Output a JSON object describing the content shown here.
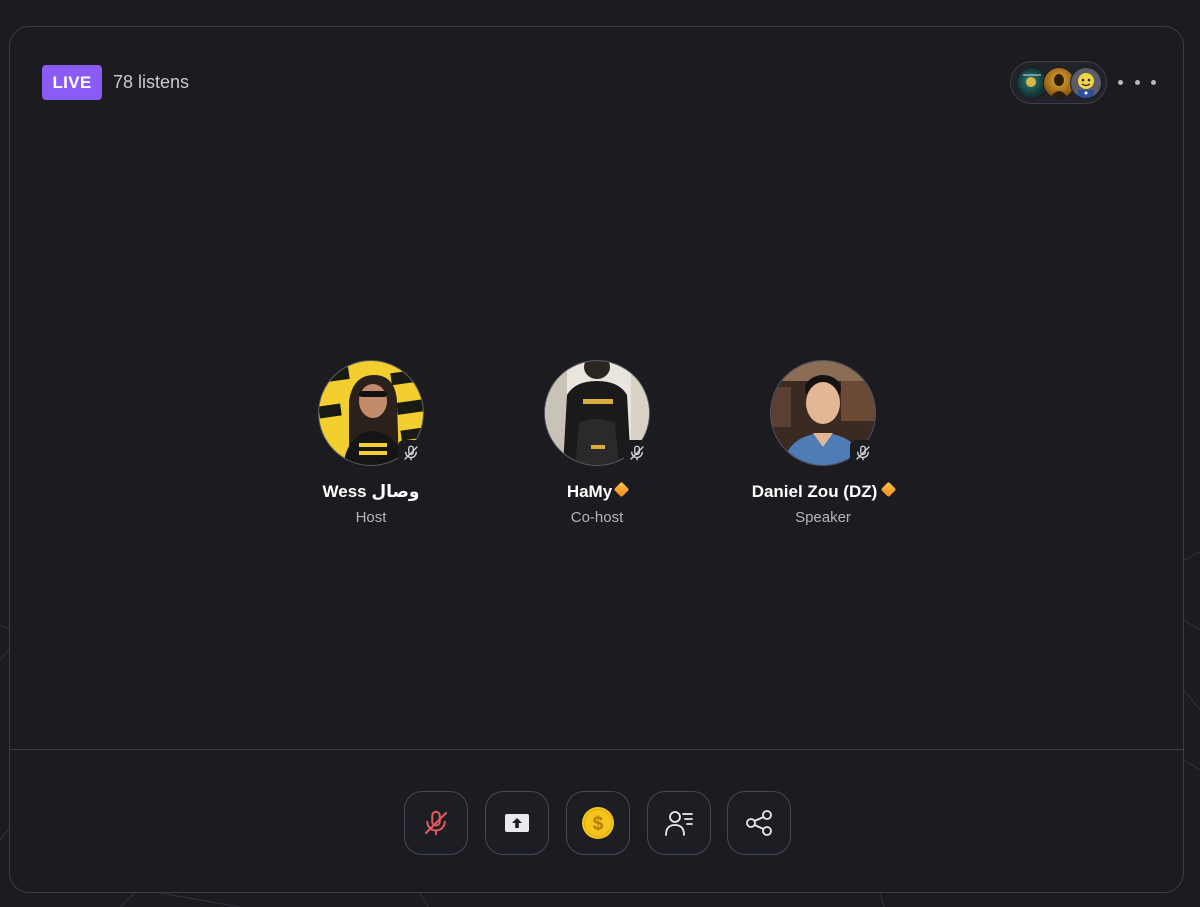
{
  "room": {
    "live_label": "LIVE",
    "listens_text": "78 listens"
  },
  "listeners": [
    {
      "icon": "listener-avatar"
    },
    {
      "icon": "listener-avatar"
    },
    {
      "icon": "listener-avatar"
    }
  ],
  "speakers": [
    {
      "name": "Wess وصال",
      "role": "Host",
      "verified": false,
      "muted": true
    },
    {
      "name": "HaMy",
      "role": "Co-host",
      "verified": true,
      "muted": true
    },
    {
      "name": "Daniel Zou (DZ)",
      "role": "Speaker",
      "verified": true,
      "muted": true
    }
  ],
  "controls": [
    {
      "icon": "mic-off-icon"
    },
    {
      "icon": "share-screen-icon"
    },
    {
      "icon": "tip-coin-icon"
    },
    {
      "icon": "participants-icon"
    },
    {
      "icon": "share-icon"
    }
  ],
  "colors": {
    "accent": "#8a5cf5",
    "background": "#1b1b20",
    "border": "#3b3d48",
    "mic_off": "#e5595f",
    "coin": "#f3c51d",
    "verified": "#f5a524"
  }
}
